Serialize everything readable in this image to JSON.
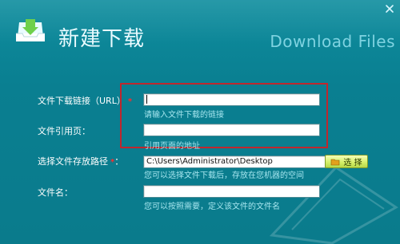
{
  "dialog": {
    "title": "新建下载",
    "subtitle": "Download Files",
    "close_symbol": "×"
  },
  "form": {
    "url_label": "文件下载链接（URL）",
    "url_value": "",
    "url_hint": "请输入文件下载的链接",
    "ref_label": "文件引用页：",
    "ref_value": "",
    "ref_hint": "引用页面的地址",
    "path_label": "选择文件存放路径",
    "path_value": "C:\\Users\\Administrator\\Desktop",
    "path_hint": "您可以选择文件下载后，存放在您机器的空间",
    "select_button_label": "选 择",
    "filename_label": "文件名：",
    "filename_value": "",
    "filename_hint": "您可以按照需要，定义该文件的文件名"
  },
  "colors": {
    "accent_highlight": "#c0272d",
    "window_bg": "#0a7f91",
    "button_bg": "#d6f06a"
  },
  "icons": {
    "logo": "download-tray-icon",
    "close": "close-icon",
    "folder": "folder-icon"
  }
}
